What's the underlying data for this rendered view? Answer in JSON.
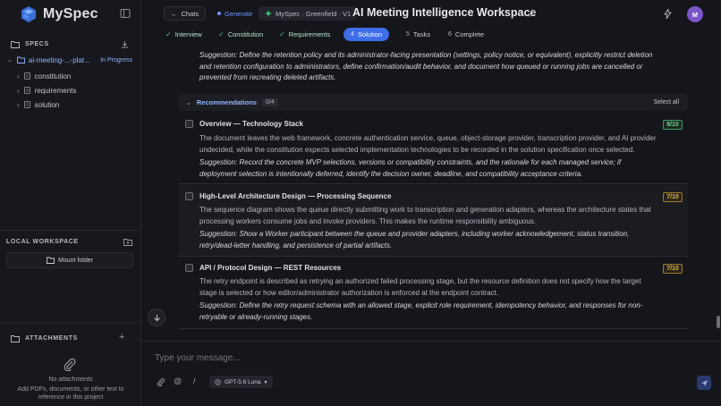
{
  "app": {
    "name": "MySpec"
  },
  "sidebar": {
    "specs_heading": "SPECS",
    "project": {
      "name": "ai-meeting-...-plat...",
      "status": "In Progress"
    },
    "files": [
      "constitution",
      "requirements",
      "solution"
    ],
    "local_workspace_heading": "LOCAL WORKSPACE",
    "mount_label": "Mount folder",
    "attachments_heading": "ATTACHMENTS",
    "no_attachments": "No attachments",
    "attachments_hint_line1": "Add PDFs, documents, or other text to",
    "attachments_hint_line2": "reference in this project"
  },
  "header": {
    "chats_label": "Chats",
    "generate_label": "Generate",
    "project_chip": "MySpec · Greenfield · V1",
    "title": "AI Meeting Intelligence Workspace",
    "avatar_initial": "M"
  },
  "tabs": [
    {
      "label": "Interview",
      "state": "done"
    },
    {
      "label": "Constitution",
      "state": "done"
    },
    {
      "label": "Requirements",
      "state": "done"
    },
    {
      "num": "4",
      "label": "Solution",
      "state": "current"
    },
    {
      "num": "5",
      "label": "Tasks",
      "state": "todo"
    },
    {
      "num": "6",
      "label": "Complete",
      "state": "todo"
    }
  ],
  "top_suggestion": {
    "line1": "Suggestion: Define the retention policy and its administrator-facing presentation (settings, policy notice, or equivalent), explicitly restrict deletion",
    "line2": "and retention configuration to administrators, define confirmation/audit behavior, and document how queued or running jobs are cancelled or",
    "line3": "prevented from recreating deleted artifacts."
  },
  "recommendations": {
    "heading": "Recommendations",
    "count": "0/4",
    "select_all": "Select all",
    "items": [
      {
        "title": "Overview — Technology Stack",
        "score": "8/10",
        "desc1": "The document leaves the web framework, concrete authentication service, queue, object-storage provider, transcription provider, and AI provider",
        "desc2": "undecided, while the constitution expects selected implementation technologies to be recorded in the solution specification once selected.",
        "sug1": "Suggestion: Record the concrete MVP selections, versions or compatibility constraints, and the rationale for each managed service; if",
        "sug2": "deployment selection is intentionally deferred, identify the decision owner, deadline, and compatibility acceptance criteria."
      },
      {
        "title": "High-Level Architecture Design — Processing Sequence",
        "score": "7/10",
        "desc1": "The sequence diagram shows the queue directly submitting work to transcription and generation adapters, whereas the architecture states that",
        "desc2": "processing workers consume jobs and invoke providers. This makes the runtime responsibility ambiguous.",
        "sug1": "Suggestion: Show a Worker participant between the queue and provider adapters, including worker acknowledgement, status transition,",
        "sug2": "retry/dead-letter handling, and persistence of partial artifacts."
      },
      {
        "title": "API / Protocol Design — REST Resources",
        "score": "7/10",
        "desc1": "The retry endpoint is described as retrying an authorized failed processing stage, but the resource definition does not specify how the target",
        "desc2": "stage is selected or how editor/administrator authorization is enforced at the endpoint contract.",
        "sug1": "Suggestion: Define the retry request schema with an allowed stage, explicit role requirement, idempotency behavior, and responses for non-",
        "sug2": "retryable or already-running stages."
      }
    ]
  },
  "composer": {
    "placeholder": "Type your message...",
    "model": "GPT-5.6 Luna"
  },
  "colors": {
    "accent": "#3e6ee8",
    "success": "#45c27a",
    "warning": "#e1b447"
  }
}
